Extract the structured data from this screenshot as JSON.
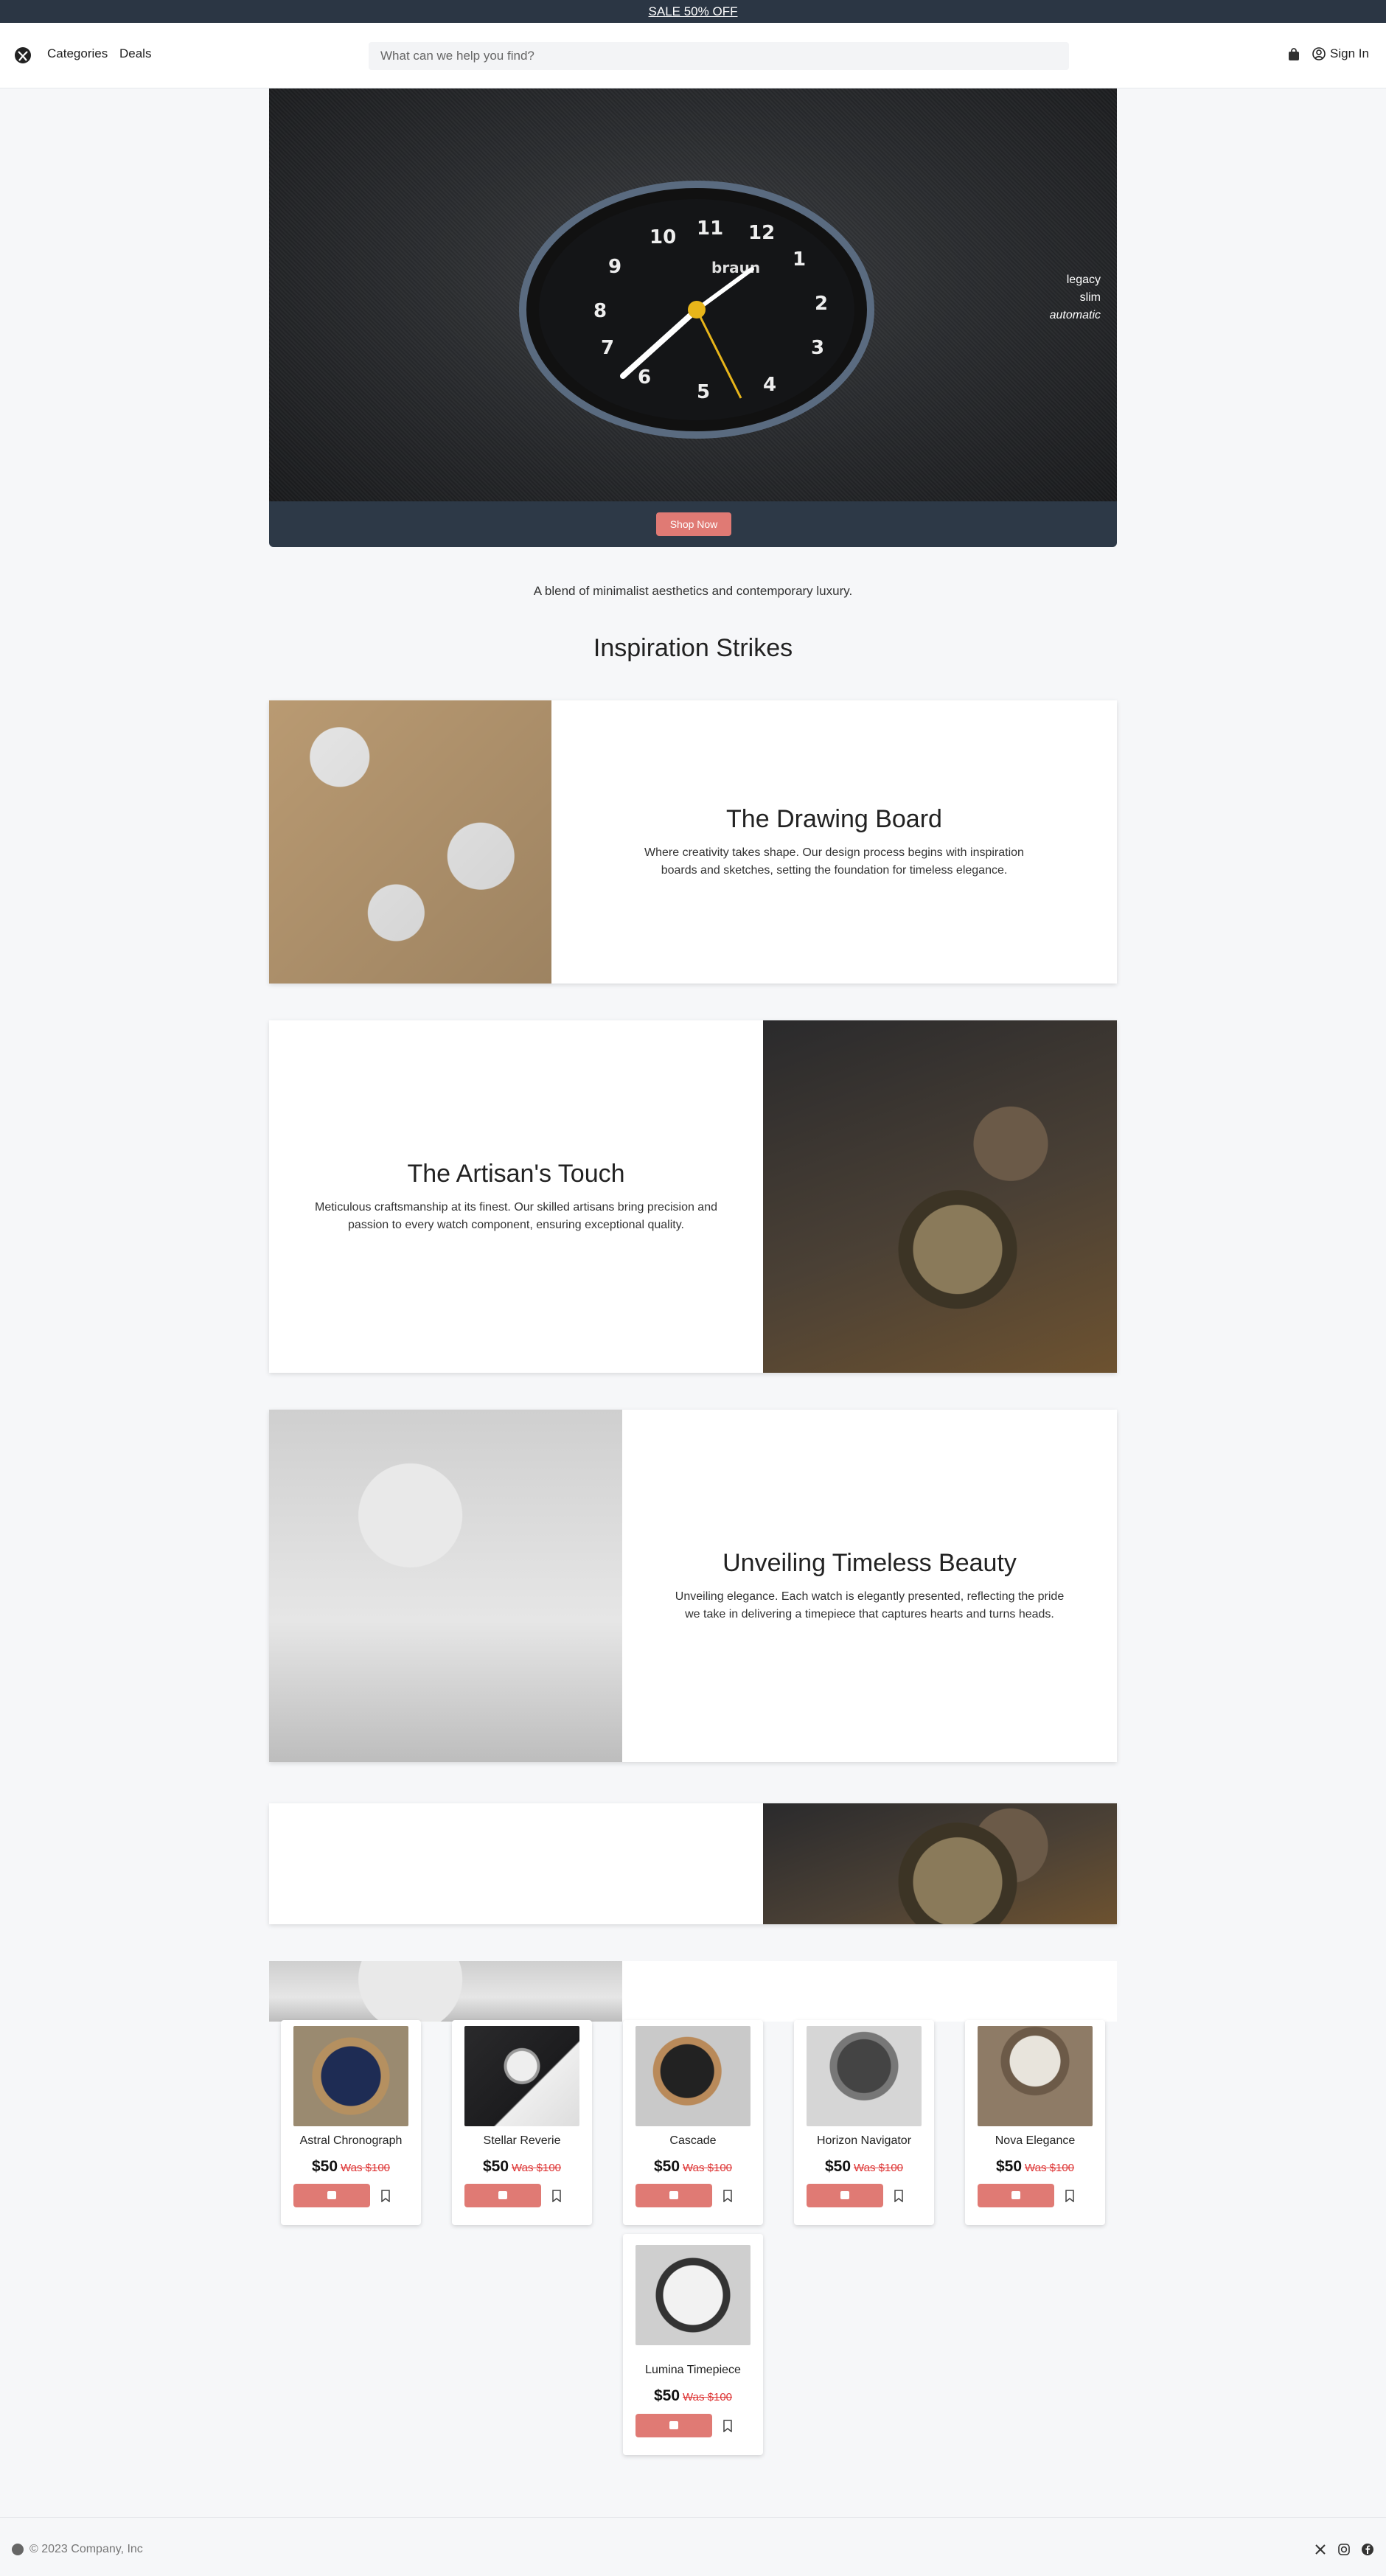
{
  "promo": {
    "text": "SALE 50% OFF"
  },
  "nav": {
    "categories": "Categories",
    "deals": "Deals",
    "search_placeholder": "What can we help you find?",
    "signin": "Sign In"
  },
  "hero": {
    "lines": [
      "legacy",
      "slim",
      "automatic"
    ],
    "cta": "Shop Now"
  },
  "tagline": "A blend of minimalist aesthetics and contemporary luxury.",
  "section_title": "Inspiration Strikes",
  "features": [
    {
      "title": "The Drawing Board",
      "text": "Where creativity takes shape. Our design process begins with inspiration boards and sketches, setting the foundation for timeless elegance."
    },
    {
      "title": "The Artisan's Touch",
      "text": "Meticulous craftsmanship at its finest. Our skilled artisans bring precision and passion to every watch component, ensuring exceptional quality."
    },
    {
      "title": "Unveiling Timeless Beauty",
      "text": "Unveiling elegance. Each watch is elegantly presented, reflecting the pride we take in delivering a timepiece that captures hearts and turns heads."
    }
  ],
  "products": [
    {
      "name": "Astral Chronograph",
      "price": "$50",
      "was": "Was $100",
      "color": "#2e3a5a"
    },
    {
      "name": "Stellar Reverie",
      "price": "$50",
      "was": "Was $100",
      "color": "#3b3b3d"
    },
    {
      "name": "Cascade",
      "price": "$50",
      "was": "Was $100",
      "color": "#5e4a36"
    },
    {
      "name": "Horizon Navigator",
      "price": "$50",
      "was": "Was $100",
      "color": "#4b4d50"
    },
    {
      "name": "Nova Elegance",
      "price": "$50",
      "was": "Was $100",
      "color": "#6c5a48"
    },
    {
      "name": "Lumina Timepiece",
      "price": "$50",
      "was": "Was $100",
      "color": "#9a9ca0"
    }
  ],
  "footer": {
    "copyright": "© 2023 Company, Inc"
  },
  "icons": [
    "logo-icon",
    "shopping-bag-icon",
    "user-circle-icon",
    "bookmark-icon",
    "x-twitter-icon",
    "instagram-icon",
    "facebook-icon"
  ],
  "colors": {
    "accent": "#e07a74",
    "dark": "#2b3644",
    "sale": "#d33333"
  }
}
